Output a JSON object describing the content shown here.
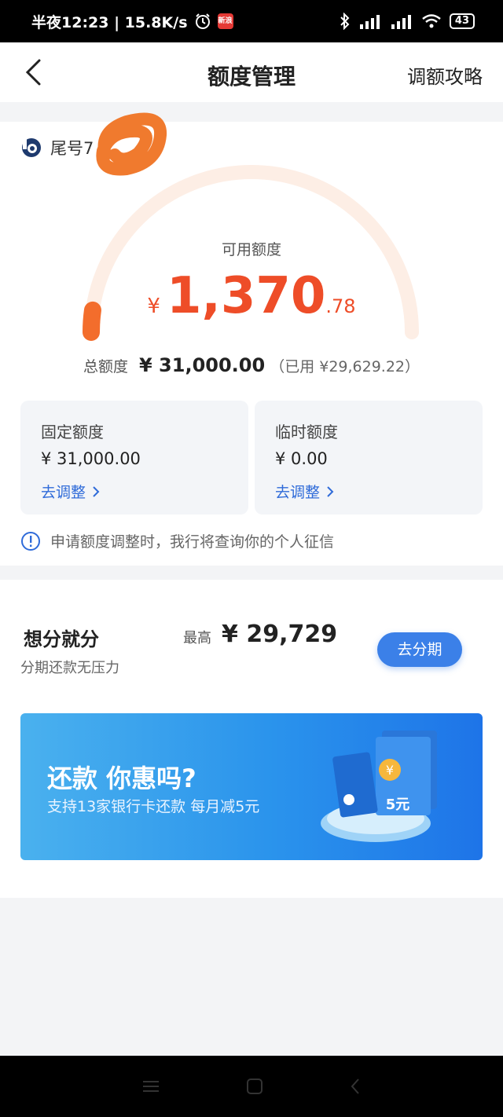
{
  "status_bar": {
    "time": "半夜12:23 | 15.8K/s",
    "app_badge": "新浪",
    "battery": "43"
  },
  "nav": {
    "title": "额度管理",
    "right_link": "调额攻略"
  },
  "account": {
    "label": "尾号7"
  },
  "credit": {
    "available_label": "可用额度",
    "currency": "¥",
    "available_int": "1,370",
    "available_dec": ".78",
    "gauge_fraction": 0.044,
    "total_label": "总额度",
    "total_value": "¥ 31,000.00",
    "used_text": "（已用 ¥29,629.22）"
  },
  "fixed_limit": {
    "label": "固定额度",
    "value": "¥ 31,000.00",
    "link": "去调整"
  },
  "temp_limit": {
    "label": "临时额度",
    "value": "¥ 0.00",
    "link": "去调整"
  },
  "notice": {
    "text": "申请额度调整时，我行将查询你的个人征信"
  },
  "installment": {
    "title": "想分就分",
    "subtitle": "分期还款无压力",
    "max_label": "最高",
    "max_amount": "¥ 29,729",
    "button": "去分期"
  },
  "banner": {
    "title": "还款 你惠吗?",
    "subtitle": "支持13家银行卡还款 每月减5元",
    "art_coin": "¥",
    "art_card_text": "5元"
  },
  "colors": {
    "accent_red": "#ee4d28",
    "link_blue": "#2f6bd9",
    "button_blue": "#3b80e8"
  }
}
